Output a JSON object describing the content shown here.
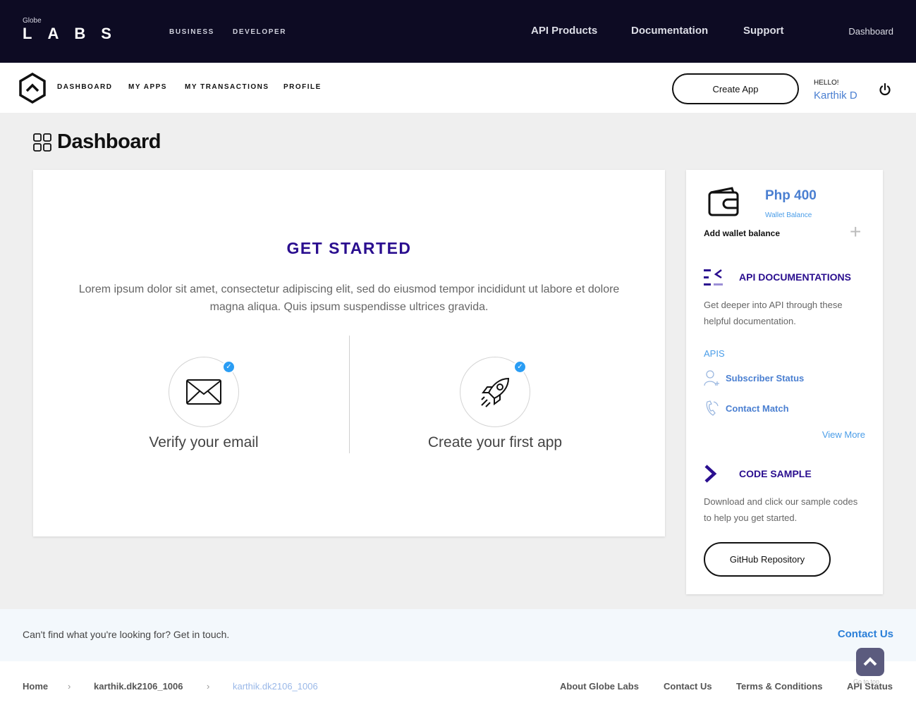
{
  "topbar": {
    "logo_small": "Globe",
    "logo_main": "LABS",
    "sub_links": [
      "BUSINESS",
      "DEVELOPER"
    ],
    "nav": [
      "API Products",
      "Documentation",
      "Support"
    ],
    "dashboard_link": "Dashboard"
  },
  "subnav": {
    "items": [
      "DASHBOARD",
      "MY APPS",
      "MY TRANSACTIONS",
      "PROFILE"
    ],
    "create_app": "Create App",
    "hello": "HELLO!",
    "username": "Karthik D"
  },
  "page": {
    "title": "Dashboard"
  },
  "get_started": {
    "title": "GET STARTED",
    "text": "Lorem ipsum dolor sit amet, consectetur adipiscing elit, sed do eiusmod tempor incididunt ut labore et dolore magna aliqua. Quis ipsum suspendisse ultrices gravida.",
    "steps": [
      {
        "label": "Verify your email",
        "icon": "envelope-icon"
      },
      {
        "label": "Create your first app",
        "icon": "rocket-icon"
      }
    ]
  },
  "sidebar": {
    "wallet_amount": "Php 400",
    "wallet_label": "Wallet Balance",
    "add_wallet": "Add wallet balance",
    "api_docs_title": "API DOCUMENTATIONS",
    "api_docs_text": "Get deeper into API through these helpful documentation.",
    "apis_label": "APIS",
    "apis": [
      "Subscriber Status",
      "Contact Match"
    ],
    "view_more": "View More",
    "code_title": "CODE SAMPLE",
    "code_text": "Download and click our sample codes to help you get started.",
    "github_button": "GitHub Repository"
  },
  "contact": {
    "text": "Can't find what you're looking for? Get in touch.",
    "link": "Contact Us"
  },
  "footer": {
    "breadcrumb": [
      "Home",
      "karthik.dk2106_1006",
      "karthik.dk2106_1006"
    ],
    "links": [
      "About Globe Labs",
      "Contact Us",
      "Terms & Conditions",
      "API Status"
    ],
    "back_to_top": "Go to top"
  },
  "colors": {
    "header_bg": "#0d0b23",
    "accent_purple": "#2a0e8f",
    "accent_blue": "#4a7fd1",
    "check_blue": "#2a9df4"
  }
}
